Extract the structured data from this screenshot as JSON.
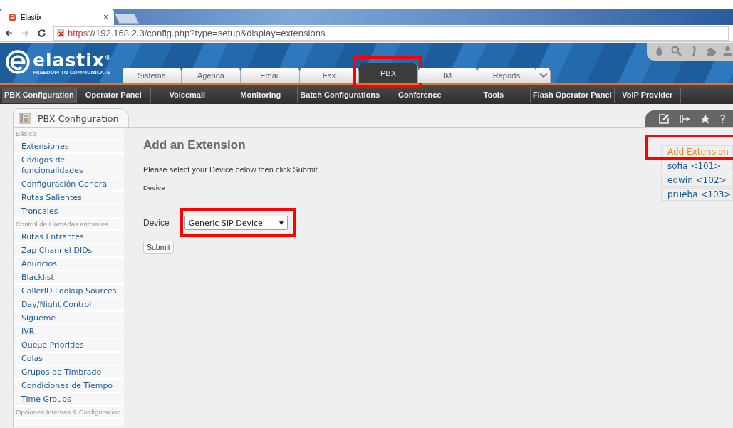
{
  "browser": {
    "tab_title": "Elastix",
    "tab_close": "×",
    "url_scheme": "https",
    "url_rest": "://192.168.2.3/config.php?type=setup&display=extensions"
  },
  "header": {
    "logo": "elastix",
    "logo_mark": "®",
    "tagline": "FREEDOM TO COMMUNICATE"
  },
  "main_tabs": [
    {
      "label": "Sistema",
      "selected": false,
      "highlighted": false
    },
    {
      "label": "Agenda",
      "selected": false,
      "highlighted": false
    },
    {
      "label": "Email",
      "selected": false,
      "highlighted": false
    },
    {
      "label": "Fax",
      "selected": false,
      "highlighted": false
    },
    {
      "label": "PBX",
      "selected": true,
      "highlighted": true
    },
    {
      "label": "IM",
      "selected": false,
      "highlighted": false
    },
    {
      "label": "Reports",
      "selected": false,
      "highlighted": false
    }
  ],
  "sub_menu": [
    {
      "label": "PBX Configuration",
      "selected": true
    },
    {
      "label": "Operator Panel",
      "selected": false
    },
    {
      "label": "Voicemail",
      "selected": false
    },
    {
      "label": "Monitoring",
      "selected": false
    },
    {
      "label": "Batch Configurations",
      "selected": false
    },
    {
      "label": "Conference",
      "selected": false
    },
    {
      "label": "Tools",
      "selected": false
    },
    {
      "label": "Flash Operator Panel",
      "selected": false
    },
    {
      "label": "VoIP Provider",
      "selected": false
    }
  ],
  "panel_tab": "PBX Configuration",
  "sidebar": [
    {
      "kind": "group",
      "label": "Básico"
    },
    {
      "kind": "link",
      "label": "Extensiones"
    },
    {
      "kind": "link",
      "label": "Códigos de funcionalidades"
    },
    {
      "kind": "link",
      "label": "Configuración General"
    },
    {
      "kind": "link",
      "label": "Rutas Salientes"
    },
    {
      "kind": "link",
      "label": "Troncales"
    },
    {
      "kind": "group",
      "label": "Control de Llamadas entrantes"
    },
    {
      "kind": "link",
      "label": "Rutas Entrantes"
    },
    {
      "kind": "link",
      "label": "Zap Channel DIDs"
    },
    {
      "kind": "link",
      "label": "Anuncios"
    },
    {
      "kind": "link",
      "label": "Blacklist"
    },
    {
      "kind": "link",
      "label": "CallerID Lookup Sources"
    },
    {
      "kind": "link",
      "label": "Day/Night Control"
    },
    {
      "kind": "link",
      "label": "Sígueme"
    },
    {
      "kind": "link",
      "label": "IVR"
    },
    {
      "kind": "link",
      "label": "Queue Priorities"
    },
    {
      "kind": "link",
      "label": "Colas"
    },
    {
      "kind": "link",
      "label": "Grupos de Timbrado"
    },
    {
      "kind": "link",
      "label": "Condiciones de Tiempo"
    },
    {
      "kind": "link",
      "label": "Time Groups"
    },
    {
      "kind": "group",
      "label": "Opciones Internas & Configuración"
    }
  ],
  "form": {
    "title": "Add an Extension",
    "instruction": "Please select your Device below then click Submit",
    "section": "Device",
    "device_label": "Device",
    "device_value": "Generic SIP Device",
    "device_highlighted": true,
    "submit": "Submit"
  },
  "extensions": [
    {
      "label": "Add Extension",
      "selected": true,
      "highlighted": true
    },
    {
      "label": "sofia <101>",
      "selected": false,
      "highlighted": false
    },
    {
      "label": "edwin <102>",
      "selected": false,
      "highlighted": false
    },
    {
      "label": "prueba <103>",
      "selected": false,
      "highlighted": false
    }
  ],
  "panel_tools": [
    "?"
  ]
}
